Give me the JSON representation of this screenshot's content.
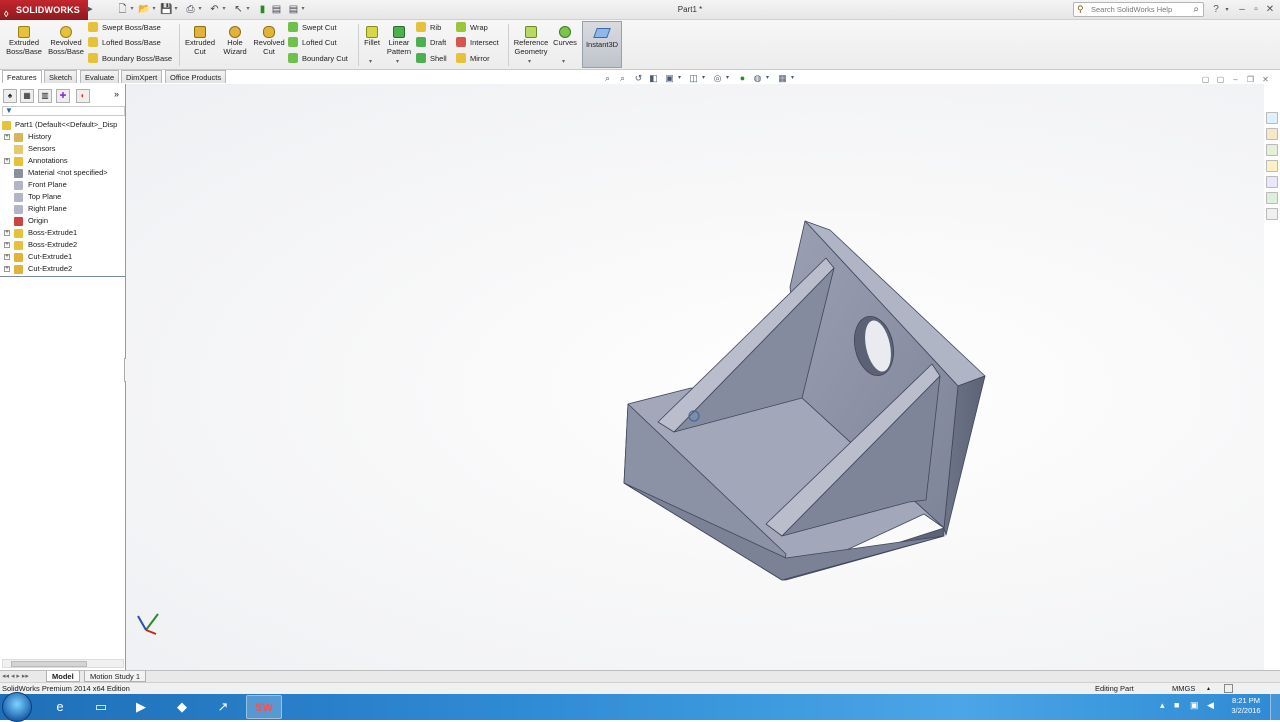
{
  "app": {
    "logo_text": "SOLIDWORKS",
    "window_title": "Part1 *",
    "search_placeholder": "Search SolidWorks Help"
  },
  "ribbon": {
    "extruded_boss": "Extruded Boss/Base",
    "revolved_boss": "Revolved Boss/Base",
    "swept_boss": "Swept Boss/Base",
    "lofted_boss": "Lofted Boss/Base",
    "boundary_boss": "Boundary Boss/Base",
    "extruded_cut": "Extruded Cut",
    "hole_wizard": "Hole Wizard",
    "revolved_cut": "Revolved Cut",
    "swept_cut": "Swept Cut",
    "lofted_cut": "Lofted Cut",
    "boundary_cut": "Boundary Cut",
    "fillet": "Fillet",
    "linear_pattern": "Linear Pattern",
    "rib": "Rib",
    "draft": "Draft",
    "shell": "Shell",
    "wrap": "Wrap",
    "intersect": "Intersect",
    "mirror": "Mirror",
    "reference_geometry": "Reference Geometry",
    "curves": "Curves",
    "instant3d": "Instant3D"
  },
  "tabs": [
    "Features",
    "Sketch",
    "Evaluate",
    "DimXpert",
    "Office Products"
  ],
  "tree": {
    "root": "Part1  (Default<<Default>_Disp",
    "items": [
      {
        "label": "History",
        "icon": "history-icon",
        "expandable": true
      },
      {
        "label": "Sensors",
        "icon": "sensors-icon",
        "expandable": false
      },
      {
        "label": "Annotations",
        "icon": "annotations-icon",
        "expandable": true
      },
      {
        "label": "Material <not specified>",
        "icon": "material-icon",
        "expandable": false
      },
      {
        "label": "Front Plane",
        "icon": "plane-icon",
        "expandable": false
      },
      {
        "label": "Top Plane",
        "icon": "plane-icon",
        "expandable": false
      },
      {
        "label": "Right Plane",
        "icon": "plane-icon",
        "expandable": false
      },
      {
        "label": "Origin",
        "icon": "origin-icon",
        "expandable": false
      },
      {
        "label": "Boss-Extrude1",
        "icon": "boss-extrude-icon",
        "expandable": true
      },
      {
        "label": "Boss-Extrude2",
        "icon": "boss-extrude-icon",
        "expandable": true
      },
      {
        "label": "Cut-Extrude1",
        "icon": "cut-extrude-icon",
        "expandable": true
      },
      {
        "label": "Cut-Extrude2",
        "icon": "cut-extrude-icon",
        "expandable": true
      }
    ]
  },
  "bottom_tabs": [
    "Model",
    "Motion Study 1"
  ],
  "status": {
    "left": "SolidWorks Premium 2014 x64 Edition",
    "mode": "Editing Part",
    "units": "MMGS"
  },
  "taskbar": {
    "time": "8:21 PM",
    "date": "3/2/2016"
  },
  "colors": {
    "logo_red": "#c4262e",
    "model_face": "#8a90a4",
    "model_dark": "#6d7387",
    "model_light": "#a3a8ba",
    "taskbar": "#2f8ad4"
  }
}
